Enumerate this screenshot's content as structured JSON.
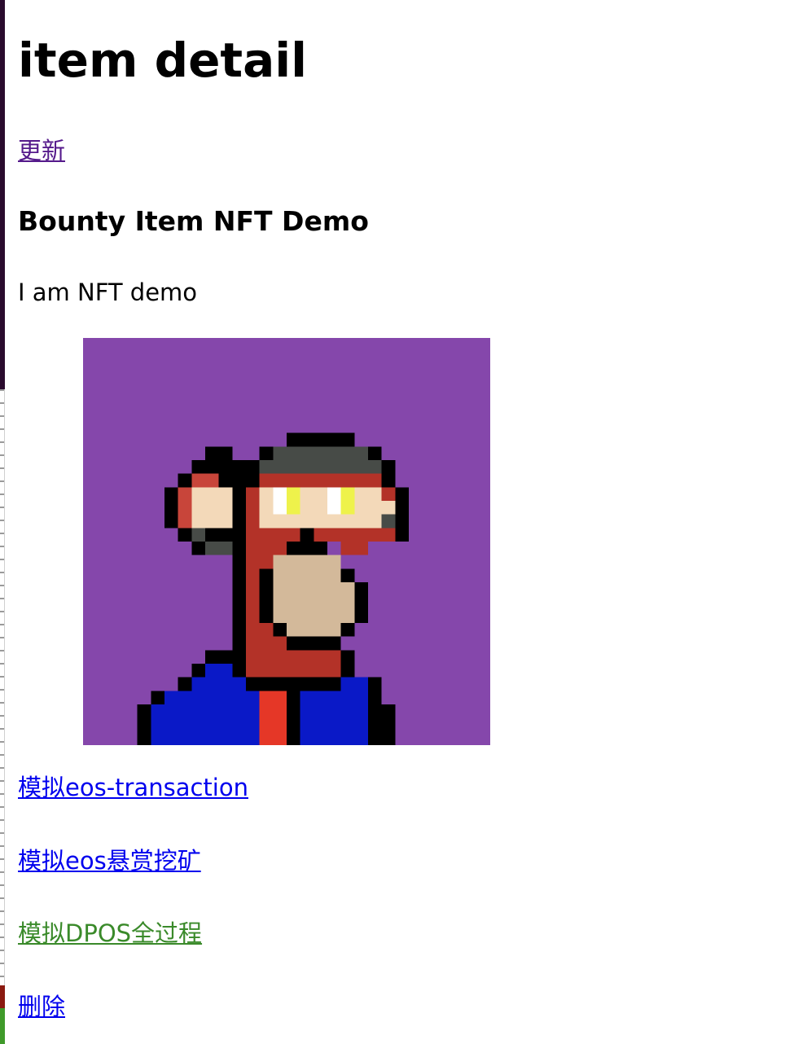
{
  "page": {
    "title": "item detail",
    "update_link": "更新"
  },
  "item": {
    "name": "Bounty Item NFT Demo",
    "description": "I am NFT demo",
    "image": {
      "icon": "pixel-ape-avatar",
      "background": "#8547ab"
    }
  },
  "actions": [
    {
      "label": "模拟eos-transaction",
      "color": "#0000ee"
    },
    {
      "label": "模拟eos悬赏挖矿",
      "color": "#0000ee"
    },
    {
      "label": "模拟DPOS全过程",
      "color": "#3a8a2a"
    },
    {
      "label": "删除",
      "color": "#0000ee"
    }
  ]
}
